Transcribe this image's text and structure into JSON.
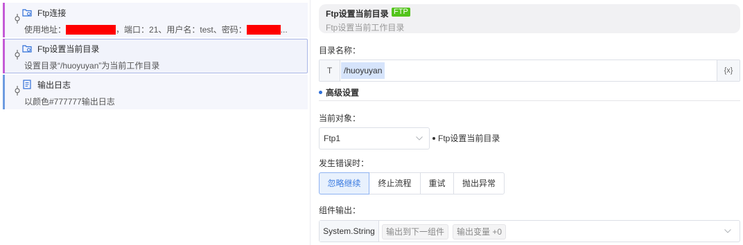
{
  "steps": [
    {
      "title": "Ftp连接",
      "desc_parts": [
        "使用地址：",
        "，端口：21、用户名：test、密码：",
        "..."
      ],
      "icon": "ftp-folder-icon",
      "bar_color": "#c45bd6"
    },
    {
      "title": "Ftp设置当前目录",
      "desc": "设置目录“/huoyuyan”为当前工作目录",
      "icon": "ftp-folder-icon",
      "bar_color": "#c45bd6"
    },
    {
      "title": "输出日志",
      "desc": "以颜色#777777输出日志",
      "icon": "log-list-icon",
      "bar_color": "#6d9be0"
    }
  ],
  "panel": {
    "title": "Ftp设置当前目录",
    "tag": "FTP",
    "subtitle": "Ftp设置当前工作目录",
    "dir_label": "目录名称：",
    "dir_prefix": "T",
    "dir_value": "/huoyuyan",
    "dir_suffix": "{x}",
    "advanced": "高级设置",
    "obj_label": "当前对象：",
    "obj_value": "Ftp1",
    "obj_name": "Ftp设置当前目录",
    "error_label": "发生错误时：",
    "error_options": [
      "忽略继续",
      "终止流程",
      "重试",
      "抛出异常"
    ],
    "error_selected": "忽略继续",
    "output_label": "组件输出：",
    "output_type": "System.String",
    "output_chips": [
      "输出到下一组件",
      "输出变量 +0"
    ]
  },
  "colors": {
    "accent": "#3b7be0",
    "ftp_tag": "#52c41a",
    "redacted": "#ff0000"
  }
}
